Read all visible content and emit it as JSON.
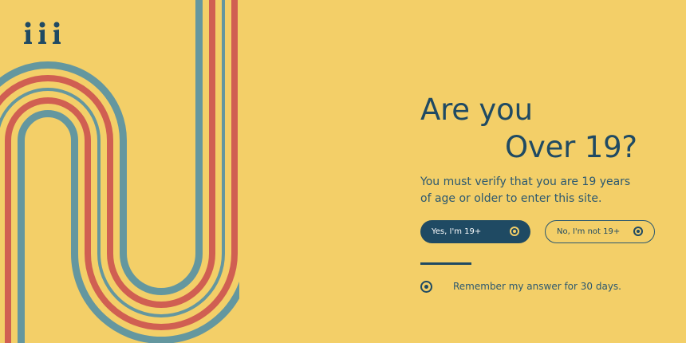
{
  "colors": {
    "background": "#f3cf68",
    "navy": "#1f4a63",
    "teal": "#64979f",
    "coral": "#d05f52"
  },
  "logo": {
    "icon": "iii-logo-icon"
  },
  "heading": {
    "line1": "Are you",
    "line2": "Over 19?"
  },
  "description": "You must verify that you are 19 years of age or older to enter this site.",
  "buttons": {
    "yes_label": "Yes, I'm 19+",
    "no_label": "No, I'm not 19+"
  },
  "remember": {
    "label": "Remember my answer for 30 days."
  }
}
